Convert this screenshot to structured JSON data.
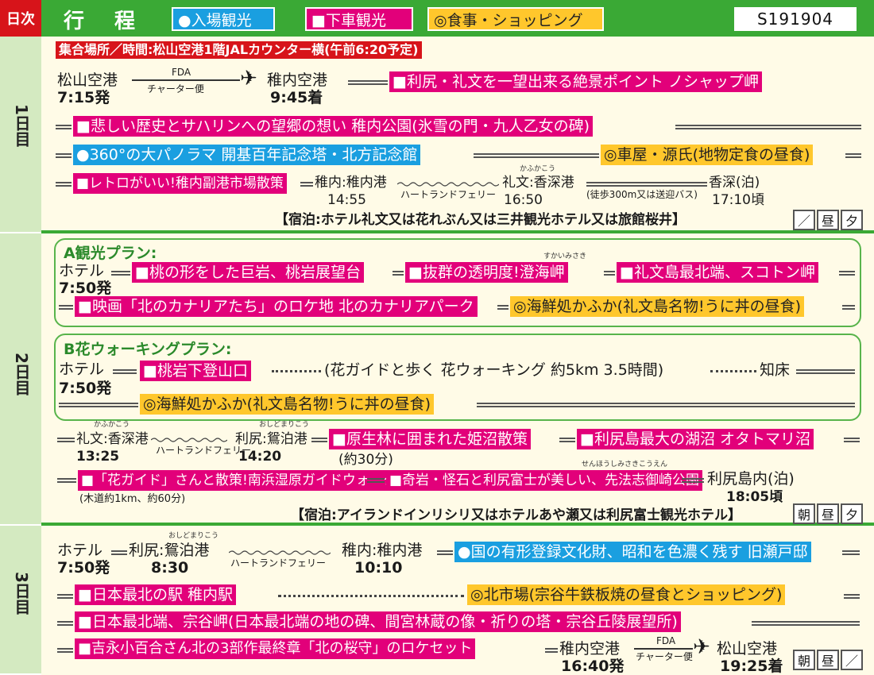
{
  "header": {
    "day_label": "日次",
    "title": "行程",
    "legend": {
      "entry": "●入場観光",
      "drop": "■下車観光",
      "meal": "◎食事・ショッピング"
    },
    "code": "S191904"
  },
  "day1": {
    "label": "1日目",
    "meeting": "集合場所／時間:松山空港1階JALカウンター横(午前6:20予定)",
    "matsuyama": "松山空港",
    "dep_time": "7:15発",
    "flight_top": "FDA",
    "flight_bottom": "チャーター便",
    "wakkanai_airport": "稚内空港",
    "arr_time": "9:45着",
    "s1": "■利尻・礼文を一望出来る絶景ポイント ノシャップ岬",
    "s2": "■悲しい歴史とサハリンへの望郷の想い 稚内公園(氷雪の門・九人乙女の碑)",
    "s3": "●360°の大パノラマ 開基百年記念塔・北方記念館",
    "m1": "◎車屋・源氏(地物定食の昼食)",
    "s4": "■レトロがいい!稚内副港市場散策",
    "port_a": "稚内:稚内港",
    "t_a": "14:55",
    "ferry": "ハートランドフェリー",
    "ruby_kafuka": "かふかこう",
    "port_b": "礼文:香深港",
    "t_b": "16:50",
    "walk": "(徒歩300m又は送迎バス)",
    "stay": "香深(泊)",
    "t_stay": "17:10頃",
    "hotel": "【宿泊:ホテル礼文又は花れぶん又は三井観光ホテル又は旅館桜井】",
    "meals": [
      "／",
      "昼",
      "夕"
    ]
  },
  "day2": {
    "label": "2日目",
    "planA": {
      "title": "A観光プラン:",
      "hotel": "ホテル",
      "time": "7:50発",
      "ruby": "すかいみさき",
      "s1": "■桃の形をした巨岩、桃岩展望台",
      "s2": "■抜群の透明度!澄海岬",
      "s3": "■礼文島最北端、スコトン岬",
      "s4": "■映画「北のカナリアたち」のロケ地 北のカナリアパーク",
      "m1": "◎海鮮処かふか(礼文島名物!うに丼の昼食)"
    },
    "planB": {
      "title": "B花ウォーキングプラン:",
      "hotel": "ホテル",
      "time": "7:50発",
      "s1": "■桃岩下登山口",
      "walk": "(花ガイドと歩く 花ウォーキング 約5km 3.5時間)",
      "dest": "知床",
      "m1": "◎海鮮処かふか(礼文島名物!うに丼の昼食)"
    },
    "ruby_kafuka": "かふかこう",
    "port_a": "礼文:香深港",
    "t_a": "13:25",
    "ferry": "ハートランドフェリー",
    "ruby_oshidomari": "おしどまりこう",
    "port_b": "利尻:鴛泊港",
    "t_b": "14:20",
    "s5": "■原生林に囲まれた姫沼散策",
    "s5_note": "(約30分)",
    "s6": "■利尻島最大の湖沼 オタトマリ沼",
    "s7": "■「花ガイド」さんと散策!南浜湿原ガイドウォーク",
    "s7_note": "(木道約1km、約60分)",
    "ruby_senpo": "せんほうしみさきこうえん",
    "s8": "■奇岩・怪石と利尻富士が美しい、先法志御崎公園",
    "stay": "利尻島内(泊)",
    "t_stay": "18:05頃",
    "hotel": "【宿泊:アイランドインリシリ又はホテルあや瀬又は利尻富士観光ホテル】",
    "meals": [
      "朝",
      "昼",
      "夕"
    ]
  },
  "day3": {
    "label": "3日目",
    "hotel": "ホテル",
    "time": "7:50発",
    "ruby_oshidomari": "おしどまりこう",
    "port_a": "利尻:鴛泊港",
    "t_a": "8:30",
    "ferry": "ハートランドフェリー",
    "port_b": "稚内:稚内港",
    "t_b": "10:10",
    "s1": "●国の有形登録文化財、昭和を色濃く残す 旧瀬戸邸",
    "s2": "■日本最北の駅 稚内駅",
    "m1": "◎北市場(宗谷牛鉄板焼の昼食とショッピング)",
    "s3": "■日本最北端、宗谷岬(日本最北端の地の碑、間宮林蔵の像・祈りの塔・宗谷丘陵展望所)",
    "s4": "■吉永小百合さん北の3部作最終章「北の桜守」のロケセット",
    "wakkanai_airport": "稚内空港",
    "dep_time": "16:40発",
    "flight_top": "FDA",
    "flight_bottom": "チャーター便",
    "matsuyama": "松山空港",
    "arr_time": "19:25着",
    "meals": [
      "朝",
      "昼",
      "／"
    ]
  },
  "colors": {
    "green": "#3aa935",
    "magenta": "#e2007a",
    "blue": "#1a9fe0",
    "yellow": "#ffc72c",
    "red": "#d7141a",
    "cream": "#fffbe7"
  }
}
